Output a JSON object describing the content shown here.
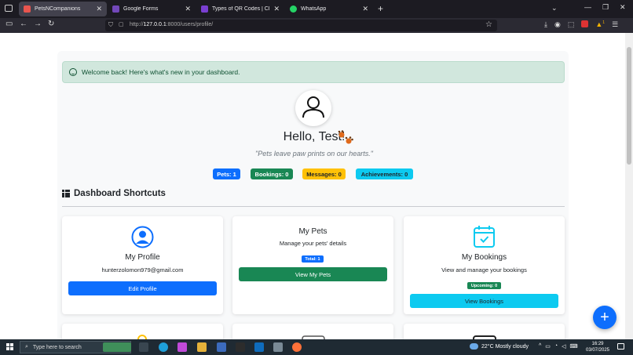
{
  "browser": {
    "tabs": [
      {
        "title": "PetsNCompanions",
        "active": true,
        "favicon_color": "#e8554e"
      },
      {
        "title": "Google Forms",
        "active": false,
        "favicon_color": "#7248b9"
      },
      {
        "title": "Types of QR Codes | Choose di",
        "active": false,
        "favicon_color": "#7a3fd1"
      },
      {
        "title": "WhatsApp",
        "active": false,
        "favicon_color": "#25d366"
      }
    ],
    "new_tab": "+",
    "url_host": "127.0.0.1",
    "url_prefix": "http://",
    "url_rest": ":8000/users/profile/",
    "ext_badge": "1"
  },
  "page": {
    "alert_text": "Welcome back! Here's what's new in your dashboard.",
    "greeting": "Hello, Test!",
    "quote": "\"Pets leave paw prints on our hearts.\"",
    "badges": [
      {
        "label": "Pets: 1",
        "bg": "#0d6efd",
        "fg": "#ffffff"
      },
      {
        "label": "Bookings: 0",
        "bg": "#198754",
        "fg": "#ffffff"
      },
      {
        "label": "Messages: 0",
        "bg": "#ffc107",
        "fg": "#212529"
      },
      {
        "label": "Achievements: 0",
        "bg": "#0dcaf0",
        "fg": "#212529"
      }
    ],
    "shortcuts_title": "Dashboard Shortcuts",
    "cards": {
      "profile": {
        "title": "My Profile",
        "email": "hunterzolomon979@gmail.com",
        "button": "Edit Profile",
        "button_color": "#0d6efd",
        "icon_color": "#0d6efd"
      },
      "pets": {
        "title": "My Pets",
        "subtitle": "Manage your pets' details",
        "mini_badge": "Total: 1",
        "mini_color": "#0d6efd",
        "button": "View My Pets",
        "button_color": "#198754"
      },
      "bookings": {
        "title": "My Bookings",
        "subtitle": "View and manage your bookings",
        "mini_badge": "Upcoming: 0",
        "mini_color": "#198754",
        "button": "View Bookings",
        "button_color": "#0dcaf0",
        "icon_color": "#0dcaf0"
      }
    },
    "fab": "+"
  },
  "taskbar": {
    "search_placeholder": "Type here to search",
    "weather": "22°C  Mostly cloudy",
    "time": "16:29",
    "date": "03/07/2025"
  }
}
